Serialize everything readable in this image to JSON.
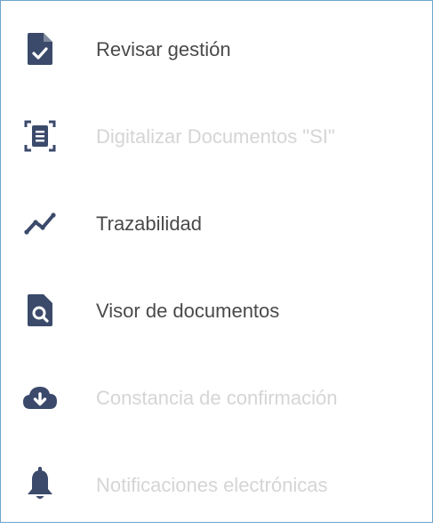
{
  "menu": {
    "items": [
      {
        "label": "Revisar gestión",
        "icon": "file-check-icon",
        "enabled": true
      },
      {
        "label": "Digitalizar Documentos \"SI\"",
        "icon": "scan-document-icon",
        "enabled": false
      },
      {
        "label": "Trazabilidad",
        "icon": "trend-line-icon",
        "enabled": true
      },
      {
        "label": "Visor de documentos",
        "icon": "file-search-icon",
        "enabled": true
      },
      {
        "label": "Constancia de confirmación",
        "icon": "cloud-download-icon",
        "enabled": false
      },
      {
        "label": "Notificaciones electrónicas",
        "icon": "bell-icon",
        "enabled": false
      }
    ]
  },
  "colors": {
    "icon": "#3b4a6b",
    "text_enabled": "#4a4a4a",
    "text_disabled": "#d5d5d5",
    "border": "#6fa3cc"
  }
}
